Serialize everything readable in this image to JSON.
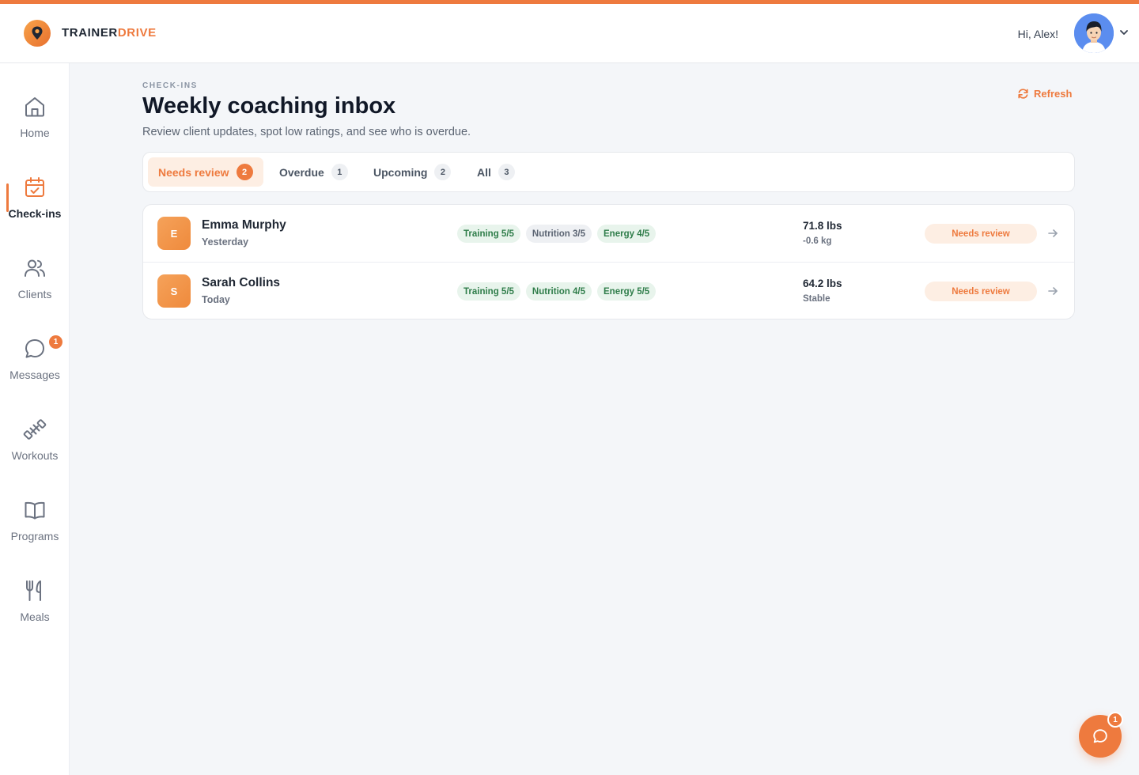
{
  "brand": {
    "name_part1": "TRAINER",
    "name_part2": "DRIVE",
    "accent_color": "#ee7a3e",
    "logo_icon": "map-pin-icon"
  },
  "user": {
    "greeting": "Hi, Alex!",
    "avatar_icon": "user-avatar"
  },
  "sidebar": {
    "items": [
      {
        "label": "Home",
        "icon": "home-icon"
      },
      {
        "label": "Check-ins",
        "icon": "calendar-check-icon",
        "active": true
      },
      {
        "label": "Clients",
        "icon": "users-icon"
      },
      {
        "label": "Messages",
        "icon": "message-icon",
        "badge": "1"
      },
      {
        "label": "Workouts",
        "icon": "dumbbell-icon"
      },
      {
        "label": "Programs",
        "icon": "book-icon"
      },
      {
        "label": "Meals",
        "icon": "utensils-icon"
      }
    ]
  },
  "header": {
    "eyebrow": "CHECK-INS",
    "title": "Weekly coaching inbox",
    "subtitle": "Review client updates, spot low ratings, and see who is overdue.",
    "refresh_label": "Refresh"
  },
  "tabs": [
    {
      "label": "Needs review",
      "count": "2",
      "active": true
    },
    {
      "label": "Overdue",
      "count": "1"
    },
    {
      "label": "Upcoming",
      "count": "2"
    },
    {
      "label": "All",
      "count": "3"
    }
  ],
  "checkins": [
    {
      "initial": "E",
      "name": "Emma Murphy",
      "when": "Yesterday",
      "ratings": [
        {
          "text": "Training 5/5",
          "tone": "good"
        },
        {
          "text": "Nutrition 3/5",
          "tone": "mid"
        },
        {
          "text": "Energy 4/5",
          "tone": "good"
        }
      ],
      "weight": "71.8 lbs",
      "delta": "-0.6 kg",
      "status": "Needs review"
    },
    {
      "initial": "S",
      "name": "Sarah Collins",
      "when": "Today",
      "ratings": [
        {
          "text": "Training 5/5",
          "tone": "good"
        },
        {
          "text": "Nutrition 4/5",
          "tone": "good"
        },
        {
          "text": "Energy 5/5",
          "tone": "good"
        }
      ],
      "weight": "64.2 lbs",
      "delta": "Stable",
      "status": "Needs review"
    }
  ],
  "chat": {
    "badge": "1"
  }
}
